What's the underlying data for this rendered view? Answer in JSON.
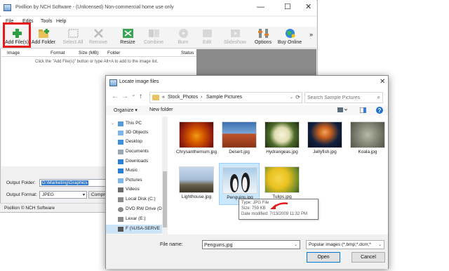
{
  "main": {
    "title": "Pixillion by NCH Software - (Unlicensed) Non-commercial home use only",
    "window_controls": {
      "minimize": "—",
      "maximize": "☐",
      "close": "✕"
    },
    "menu": [
      "File",
      "Edits",
      "Tools",
      "Help"
    ],
    "toolbar": [
      {
        "label": "Add File(s)",
        "icon": "add-icon",
        "enabled": true
      },
      {
        "label": "Add Folder",
        "icon": "folder-add-icon",
        "enabled": true
      },
      {
        "label": "Select All",
        "icon": "select-all-icon",
        "enabled": false
      },
      {
        "label": "Remove",
        "icon": "remove-icon",
        "enabled": false
      },
      {
        "label": "Resize",
        "icon": "resize-icon",
        "enabled": true
      },
      {
        "label": "Combine",
        "icon": "combine-icon",
        "enabled": false
      },
      {
        "label": "Burn",
        "icon": "burn-icon",
        "enabled": false
      },
      {
        "label": "Edit",
        "icon": "edit-icon",
        "enabled": false
      },
      {
        "label": "Slideshow",
        "icon": "slideshow-icon",
        "enabled": false
      },
      {
        "label": "Options",
        "icon": "options-icon",
        "enabled": true
      },
      {
        "label": "Buy Online",
        "icon": "globe-icon",
        "enabled": true
      }
    ],
    "toolbar_overflow": "»",
    "columns": [
      "Image",
      "Format",
      "Size (MB)",
      "Folder",
      "Status"
    ],
    "hint": "Click the \"Add File(s)\" button or type Alt+A to add to the image list.",
    "output_folder_label": "Output Folder:",
    "output_folder_value": "D:\\Marketing\\Graphics",
    "output_format_label": "Output Format:",
    "output_format_value": "JPEG",
    "compression_button": "Compression",
    "status_bar": "Pixillion © NCH Software"
  },
  "dialog": {
    "title": "Locate image files",
    "close": "✕",
    "nav": {
      "back": "←",
      "forward": "→",
      "dropdown": "⌄",
      "up": "↑"
    },
    "path_prefix": "«",
    "path": [
      "Stock_Photos",
      "Sample Pictures"
    ],
    "path_separator": "›",
    "search_placeholder": "Search Sample Pictures",
    "organize": "Organize ▾",
    "new_folder": "New folder",
    "nav_items": [
      {
        "label": "This PC",
        "icon": "computer-icon",
        "color": "#5a9bd5"
      },
      {
        "label": "3D Objects",
        "icon": "cube-icon",
        "color": "#7fb6e8"
      },
      {
        "label": "Desktop",
        "icon": "desktop-icon",
        "color": "#3d8fd8"
      },
      {
        "label": "Documents",
        "icon": "document-icon",
        "color": "#9aa7b5"
      },
      {
        "label": "Downloads",
        "icon": "download-icon",
        "color": "#2b7fd4"
      },
      {
        "label": "Music",
        "icon": "music-icon",
        "color": "#2b7fd4"
      },
      {
        "label": "Pictures",
        "icon": "picture-icon",
        "color": "#7fb6e8"
      },
      {
        "label": "Videos",
        "icon": "video-icon",
        "color": "#6c6c6c"
      },
      {
        "label": "Local Disk (C:)",
        "icon": "disk-icon",
        "color": "#8a8a8a"
      },
      {
        "label": "DVD RW Drive (D",
        "icon": "dvd-icon",
        "color": "#8a8a8a"
      },
      {
        "label": "Lexar (E:)",
        "icon": "usb-drive-icon",
        "color": "#8a8a8a"
      },
      {
        "label": "F (\\\\USA-SERVE",
        "icon": "network-drive-icon",
        "color": "#8a8a8a"
      }
    ],
    "files": [
      {
        "name": "Chrysanthemum.jpg",
        "bg": "#c0392b",
        "bg2": "#f39c12"
      },
      {
        "name": "Desert.jpg",
        "bg": "#3a6fb0",
        "bg2": "#c0552b"
      },
      {
        "name": "Hydrangeas.jpg",
        "bg": "#2e4d2a",
        "bg2": "#e8e6c8"
      },
      {
        "name": "Jellyfish.jpg",
        "bg": "#12213f",
        "bg2": "#e8873c"
      },
      {
        "name": "Koala.jpg",
        "bg": "#8c8f7e",
        "bg2": "#4f5245"
      },
      {
        "name": "Lighthouse.jpg",
        "bg": "#c7d7ea",
        "bg2": "#5a5040"
      },
      {
        "name": "Penguins.jpg",
        "bg": "#a9cbe8",
        "bg2": "#1d1d1d"
      },
      {
        "name": "Tulips.jpg",
        "bg": "#e9c11f",
        "bg2": "#6e8a2a"
      }
    ],
    "selected_file": "Penguins.jpg",
    "tooltip": [
      "Type: JPG File",
      "Size: 759 KB",
      "Date modified: 7/13/2009 11:32 PM"
    ],
    "file_name_label": "File name:",
    "file_name_value": "Penguins.jpg",
    "filter": "Popular images (*.bmp;*.dcm;*",
    "open": "Open",
    "cancel": "Cancel"
  },
  "colors": {
    "highlight": "#e51a1a",
    "preview_bg": "#8b8b8b",
    "selection": "#cce8ff"
  }
}
